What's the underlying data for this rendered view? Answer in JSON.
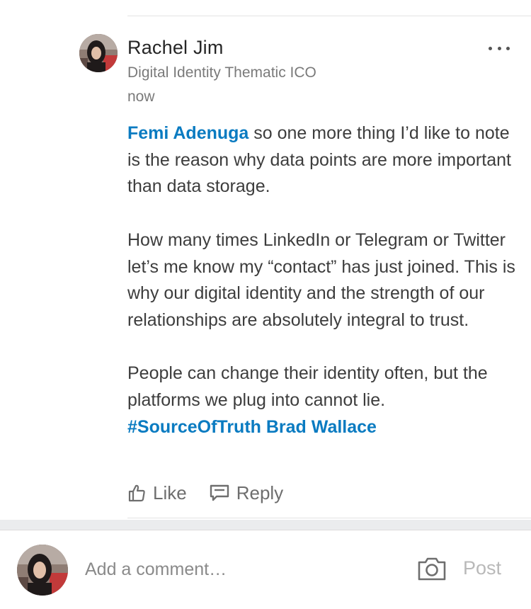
{
  "post": {
    "author_name": "Rachel Jim",
    "author_headline": "Digital Identity Thematic ICO",
    "timestamp": "now",
    "more_icon": "more-horizontal-icon",
    "body": {
      "p1_mention": "Femi Adenuga",
      "p1_text": " so one more thing I’d like to note is the reason why data points are more important than data storage.",
      "p2_text": "How many times LinkedIn or Telegram or Twitter let’s me know my “contact” has just joined. This is why our digital identity and the strength of our relationships are absolutely integral to trust.",
      "p3_text": "People can change their identity often, but the platforms we plug into cannot lie.",
      "p3_hashtag": "#SourceOfTruth",
      "p3_mention": "Brad Wallace"
    },
    "actions": {
      "like_label": "Like",
      "like_icon": "thumbs-up-icon",
      "reply_label": "Reply",
      "reply_icon": "reply-bubble-icon"
    }
  },
  "composer": {
    "placeholder": "Add a comment…",
    "camera_icon": "camera-icon",
    "post_label": "Post"
  },
  "colors": {
    "link": "#0a7bc1",
    "text": "#3d3d3d",
    "muted": "#7a7a7a",
    "post_disabled": "#b9b9b9",
    "band": "#ebecee"
  }
}
